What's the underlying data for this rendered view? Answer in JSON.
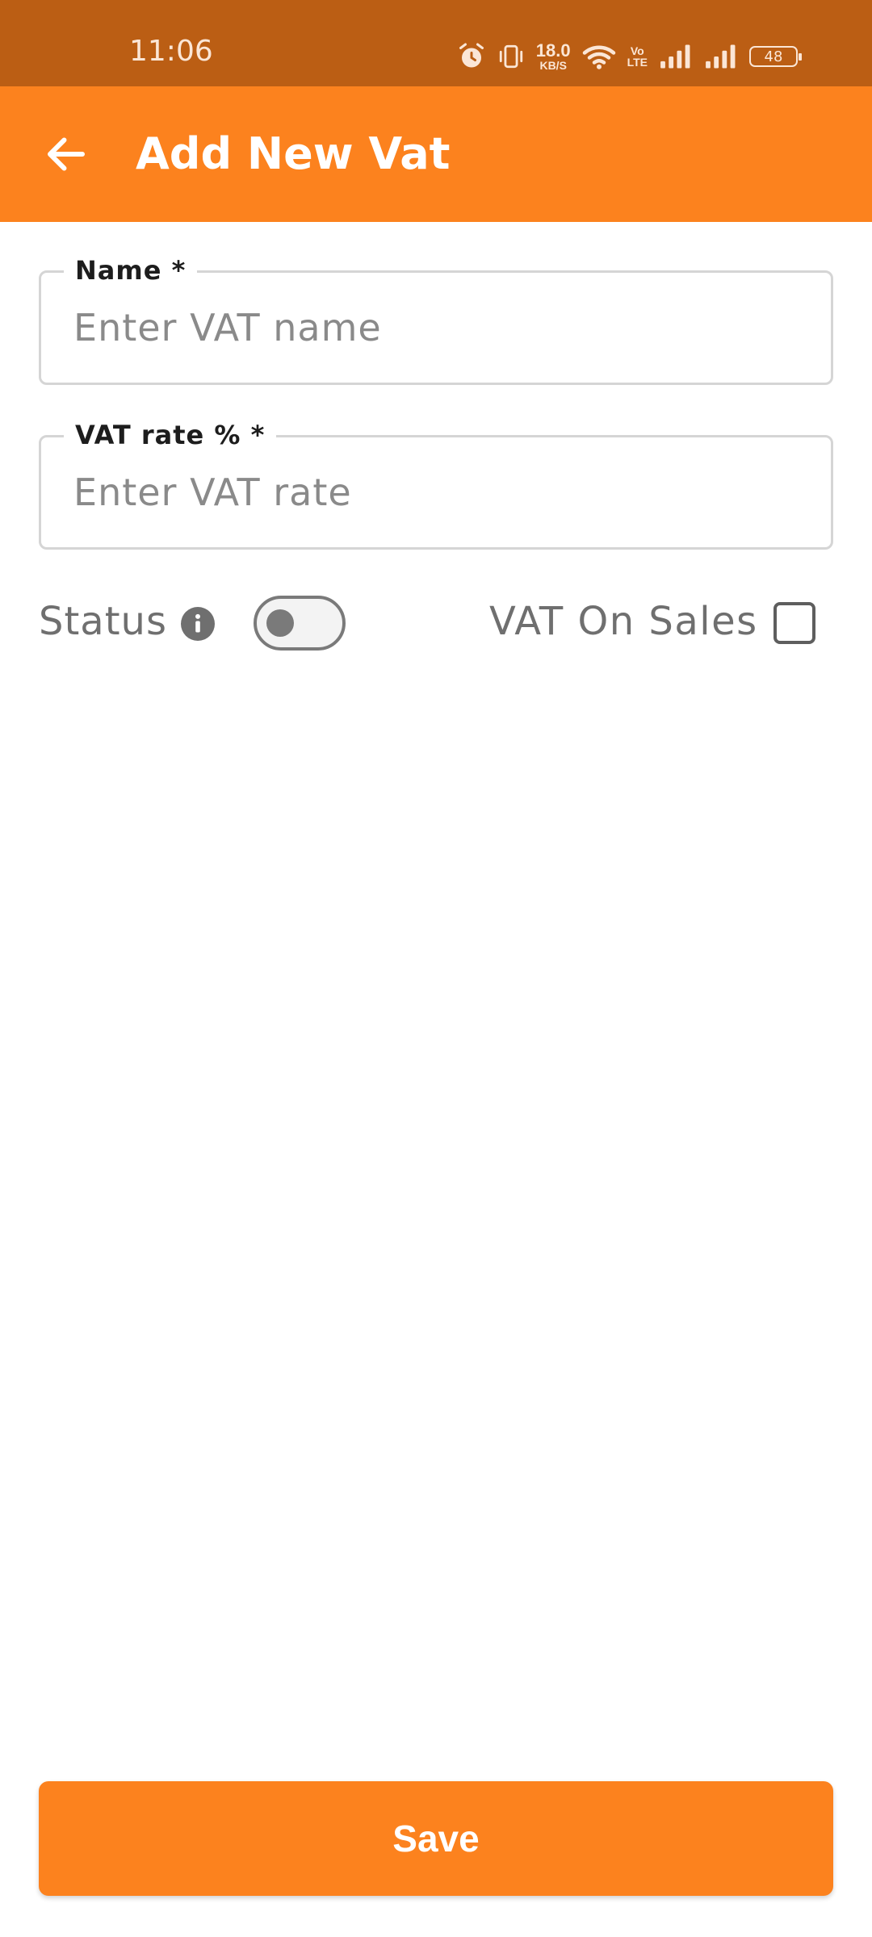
{
  "status_bar": {
    "time": "11:06",
    "net_speed_value": "18.0",
    "net_speed_unit": "KB/S",
    "volte_top": "Vo",
    "volte_bottom": "LTE",
    "battery": "48",
    "icons": [
      "alarm-icon",
      "vibrate-icon",
      "wifi-icon",
      "signal-icon",
      "signal-icon",
      "battery-icon"
    ]
  },
  "app_bar": {
    "title": "Add New Vat",
    "back_icon": "arrow-left-icon"
  },
  "form": {
    "name": {
      "label": "Name *",
      "placeholder": "Enter VAT name",
      "value": ""
    },
    "rate": {
      "label": "VAT rate % *",
      "placeholder": "Enter VAT rate",
      "value": ""
    },
    "status": {
      "label": "Status",
      "icon": "info-icon",
      "enabled": false
    },
    "vat_on_sales": {
      "label": "VAT On Sales",
      "checked": false
    }
  },
  "actions": {
    "save_label": "Save"
  },
  "colors": {
    "status_bar": "#bb5e14",
    "primary": "#fc821e",
    "input_border": "#d5d5d5",
    "muted_text": "#6f6f6f"
  }
}
